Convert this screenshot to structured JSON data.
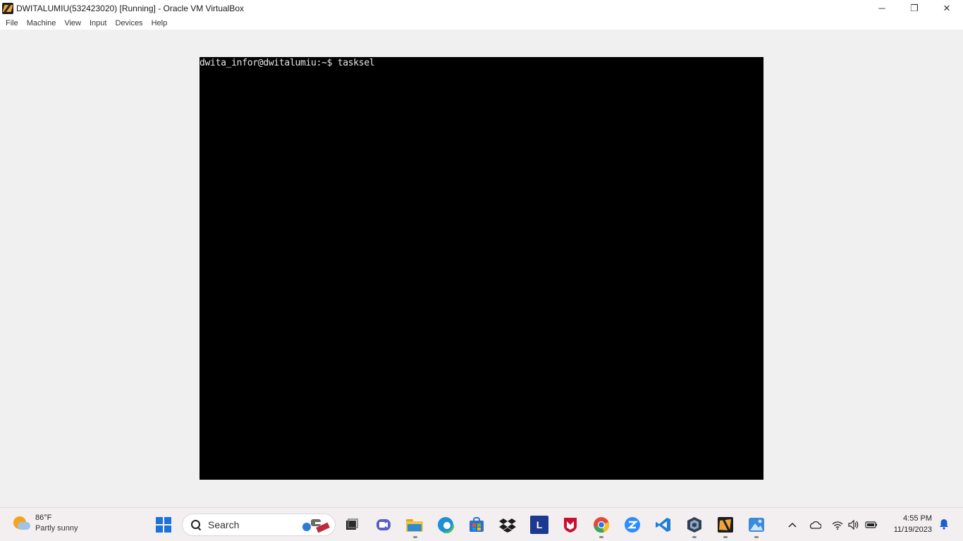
{
  "window": {
    "title": "DWITALUMIU(532423020) [Running] - Oracle VM VirtualBox",
    "minimize_glyph": "─",
    "restore_glyph": "❐",
    "close_glyph": "✕"
  },
  "menu": {
    "items": [
      "File",
      "Machine",
      "View",
      "Input",
      "Devices",
      "Help"
    ]
  },
  "terminal": {
    "prompt": "dwita_infor@dwitalumiu:~$ tasksel"
  },
  "taskbar": {
    "weather": {
      "temp": "86°F",
      "condition": "Partly sunny"
    },
    "search_label": "Search",
    "apps": [
      {
        "name": "task-view",
        "color": "#333333"
      },
      {
        "name": "teams",
        "color": "#5b5fc7"
      },
      {
        "name": "file-explorer",
        "color": "#f5c242"
      },
      {
        "name": "edge",
        "color": "#1e8fd6"
      },
      {
        "name": "microsoft-store",
        "color": "#2a6fd6"
      },
      {
        "name": "dropbox",
        "color": "#1a1a1a"
      },
      {
        "name": "l-app",
        "color": "#1b3a8f",
        "letter": "L"
      },
      {
        "name": "mcafee",
        "color": "#c8102e"
      },
      {
        "name": "chrome",
        "color": "#e24a3b"
      },
      {
        "name": "zoom",
        "color": "#2d8cff"
      },
      {
        "name": "vscode",
        "color": "#1f7fd4"
      },
      {
        "name": "vmware",
        "color": "#2f3f56"
      },
      {
        "name": "virtualbox",
        "color": "#f2a33a"
      },
      {
        "name": "photos",
        "color": "#3b8ad9"
      }
    ],
    "tray": {
      "chevron": "^",
      "time": "4:55 PM",
      "date": "11/19/2023"
    }
  }
}
